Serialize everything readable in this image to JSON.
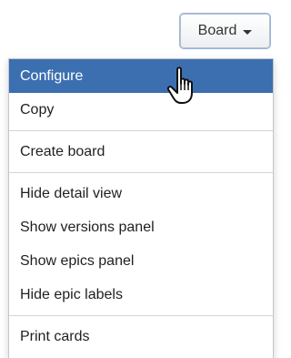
{
  "board_button": {
    "label": "Board",
    "caret_icon": "caret-down-icon"
  },
  "menu": {
    "groups": [
      {
        "items": [
          {
            "label": "Configure",
            "active": true
          },
          {
            "label": "Copy"
          }
        ]
      },
      {
        "items": [
          {
            "label": "Create board"
          }
        ]
      },
      {
        "items": [
          {
            "label": "Hide detail view"
          },
          {
            "label": "Show versions panel"
          },
          {
            "label": "Show epics panel"
          },
          {
            "label": "Hide epic labels"
          }
        ]
      },
      {
        "items": [
          {
            "label": "Print cards"
          }
        ]
      }
    ]
  },
  "cursor": "pointer-hand-icon",
  "colors": {
    "highlight": "#3c6fb0",
    "text": "#1f1f1f",
    "separator": "#d3d6da"
  }
}
